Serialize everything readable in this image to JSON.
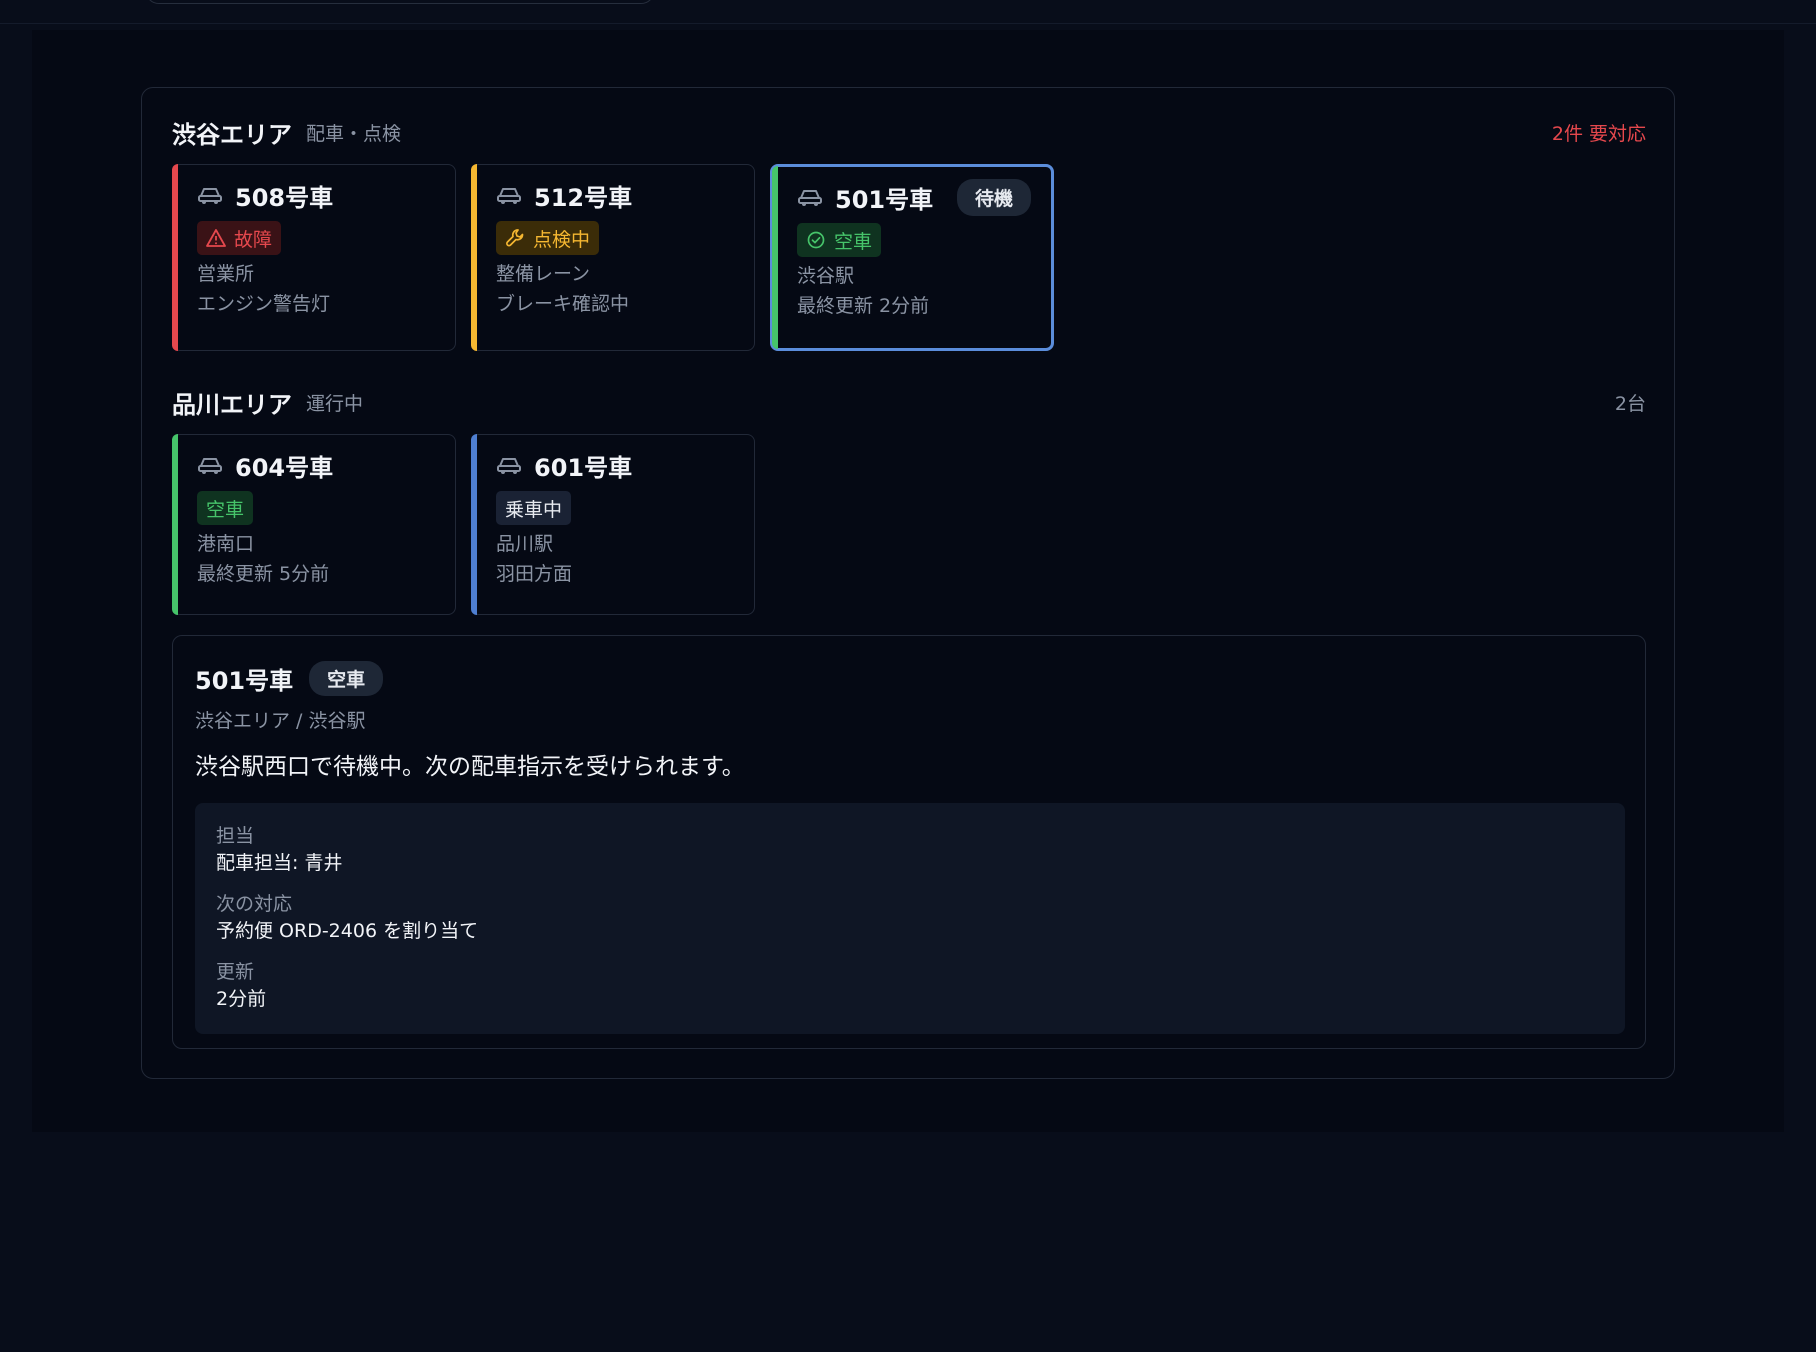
{
  "colors": {
    "fault": "#e5484d",
    "inspection": "#f5b731",
    "vacant": "#46c46a",
    "occupied": "#4f7fd1",
    "selected_border": "#5b8ddb",
    "alert_text": "#e5484d"
  },
  "groups": [
    {
      "title": "渋谷エリア",
      "subtitle": "配車・点検",
      "count": "2件 要対応",
      "vehicles": [
        {
          "name": "508号車",
          "icon": "car-icon",
          "status": "故障",
          "status_icon": "warning-icon",
          "line1": "営業所",
          "line2": "エンジン警告灯"
        },
        {
          "name": "512号車",
          "icon": "car-icon",
          "status": "点検中",
          "status_icon": "wrench-icon",
          "line1": "整備レーン",
          "line2": "ブレーキ確認中"
        },
        {
          "name": "501号車",
          "icon": "car-icon",
          "pill": "待機",
          "status": "空車",
          "status_icon": "check-circle-icon",
          "line1": "渋谷駅",
          "line2": "最終更新 2分前",
          "selected": true
        }
      ]
    },
    {
      "title": "品川エリア",
      "subtitle": "運行中",
      "count": "2台",
      "vehicles": [
        {
          "name": "604号車",
          "icon": "car-icon",
          "status": "空車",
          "line1": "港南口",
          "line2": "最終更新 5分前"
        },
        {
          "name": "601号車",
          "icon": "car-icon",
          "status": "乗車中",
          "line1": "品川駅",
          "line2": "羽田方面"
        }
      ]
    }
  ],
  "detail": {
    "title": "501号車",
    "pill": "空車",
    "breadcrumb": "渋谷エリア / 渋谷駅",
    "description": "渋谷駅西口で待機中。次の配車指示を受けられます。",
    "facts": [
      {
        "label": "担当",
        "value": "配車担当: 青井"
      },
      {
        "label": "次の対応",
        "value": "予約便 ORD-2406 を割り当て"
      },
      {
        "label": "更新",
        "value": "2分前"
      }
    ]
  }
}
